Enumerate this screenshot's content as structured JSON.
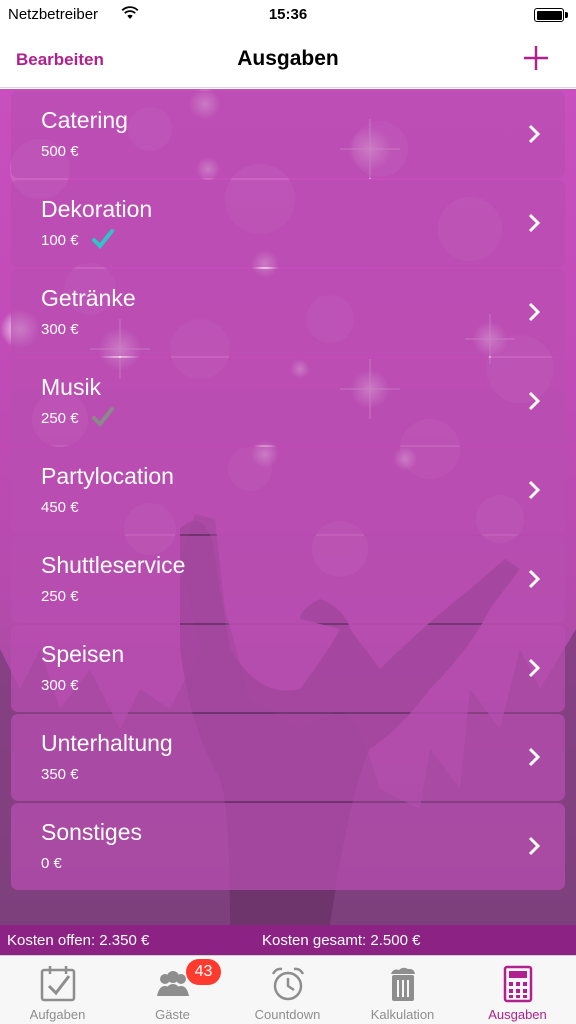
{
  "status_bar": {
    "carrier": "Netzbetreiber",
    "time": "15:36"
  },
  "nav": {
    "edit_label": "Bearbeiten",
    "title": "Ausgaben",
    "add_icon": "plus-icon"
  },
  "items": [
    {
      "name": "Catering",
      "amount": "500 €",
      "check": "none"
    },
    {
      "name": "Dekoration",
      "amount": "100 €",
      "check": "teal"
    },
    {
      "name": "Getränke",
      "amount": "300 €",
      "check": "none"
    },
    {
      "name": "Musik",
      "amount": "250 €",
      "check": "gray"
    },
    {
      "name": "Partylocation",
      "amount": "450 €",
      "check": "none"
    },
    {
      "name": "Shuttleservice",
      "amount": "250 €",
      "check": "none"
    },
    {
      "name": "Speisen",
      "amount": "300 €",
      "check": "none"
    },
    {
      "name": "Unterhaltung",
      "amount": "350 €",
      "check": "none"
    },
    {
      "name": "Sonstiges",
      "amount": "0 €",
      "check": "none"
    }
  ],
  "totals": {
    "open": "Kosten offen: 2.350 €",
    "total": "Kosten gesamt: 2.500 €"
  },
  "tabs": [
    {
      "label": "Aufgaben",
      "icon": "checklist-icon",
      "active": false
    },
    {
      "label": "Gäste",
      "icon": "guests-icon",
      "active": false
    },
    {
      "label": "Countdown",
      "icon": "alarm-clock-icon",
      "active": false
    },
    {
      "label": "Kalkulation",
      "icon": "beer-glass-icon",
      "active": false
    },
    {
      "label": "Ausgaben",
      "icon": "calculator-icon",
      "active": true
    }
  ],
  "guests_badge": "43",
  "colors": {
    "accent": "#b0208f",
    "totals_bar": "#8d2285",
    "check_teal": "#2ec4c8",
    "check_gray": "#8a8a8a"
  }
}
